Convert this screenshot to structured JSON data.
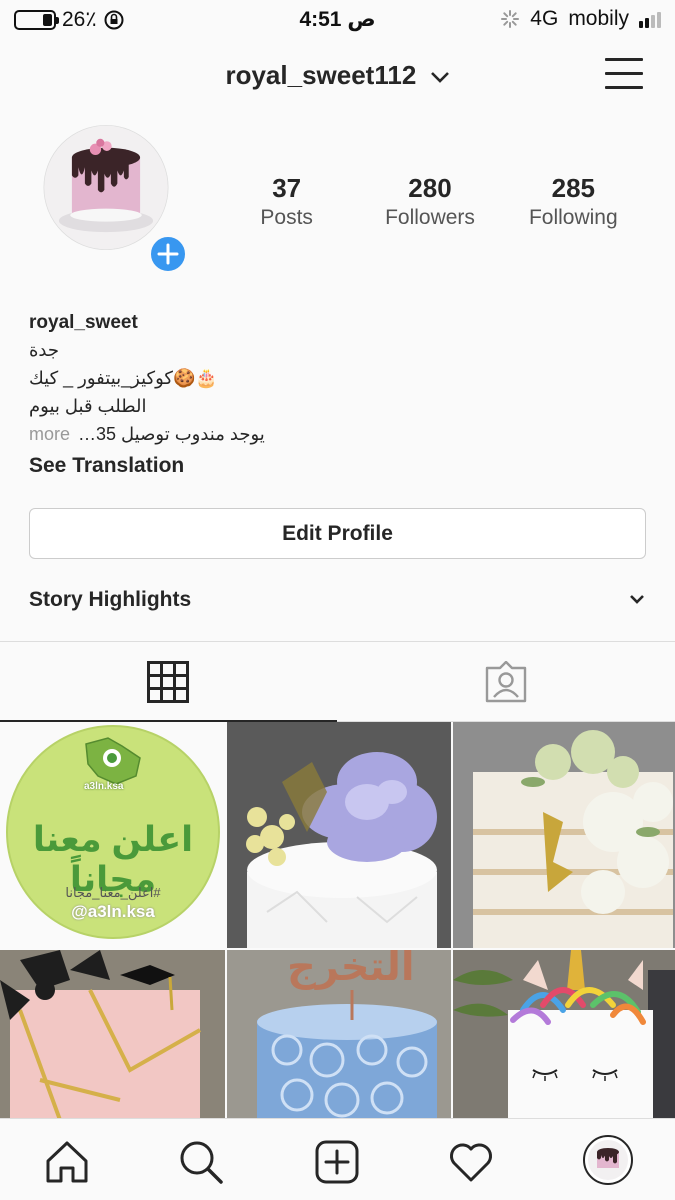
{
  "status_bar": {
    "battery": "26٪",
    "battery_level": 0.26,
    "time": "4:51 ص",
    "network": "4G",
    "carrier": "mobily"
  },
  "header": {
    "username": "royal_sweet112"
  },
  "profile": {
    "stats": [
      {
        "value": "37",
        "label": "Posts"
      },
      {
        "value": "280",
        "label": "Followers"
      },
      {
        "value": "285",
        "label": "Following"
      }
    ],
    "name": "royal_sweet",
    "bio_lines": [
      "جدة",
      "🎂🍪كوكيز_بيتفور _ كيك",
      "الطلب قبل بيوم"
    ],
    "bio_truncated": "يوجد مندوب توصيل 35…",
    "more_label": "more",
    "see_translation": "See Translation",
    "edit_profile": "Edit Profile",
    "story_highlights": "Story Highlights"
  },
  "grid_posts": [
    {
      "ad_title": "اعلن معنا مجاناً",
      "hashtag": "#اعلن_معنا_مجانا",
      "handle": "@a3ln.ksa",
      "logo": "a3ln.ksa"
    },
    {
      "caption": ""
    },
    {
      "caption": ""
    },
    {
      "caption": ""
    },
    {
      "cake_text": "التخرج"
    },
    {
      "caption": ""
    }
  ],
  "colors": {
    "accent": "#3897f0",
    "ad_green": "#c9e27a",
    "ad_text": "#4a9a3a"
  }
}
